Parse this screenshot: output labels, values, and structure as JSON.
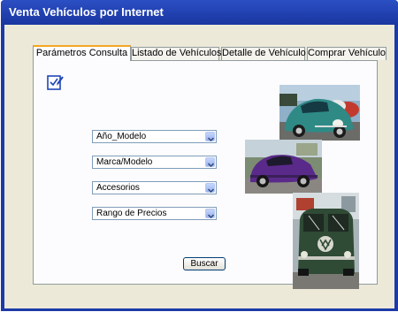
{
  "window": {
    "title": "Venta Vehículos por Internet"
  },
  "tabs": [
    {
      "label": "Parámetros Consulta",
      "active": true
    },
    {
      "label": "Listado de Vehículos",
      "active": false
    },
    {
      "label": "Detalle de Vehículo",
      "active": false
    },
    {
      "label": "Comprar Vehículo",
      "active": false
    }
  ],
  "filters": [
    {
      "value": "Año_Modelo"
    },
    {
      "value": "Marca/Modelo"
    },
    {
      "value": "Accesorios"
    },
    {
      "value": "Rango de Precios"
    }
  ],
  "search_button": {
    "label": "Buscar"
  },
  "icons": {
    "app": "checklist-pen-icon",
    "dropdown": "chevron-down-icon"
  },
  "colors": {
    "title_bar": "#1c3aa8",
    "active_tab_accent": "#f5a623",
    "client_bg": "#ece9d8"
  }
}
